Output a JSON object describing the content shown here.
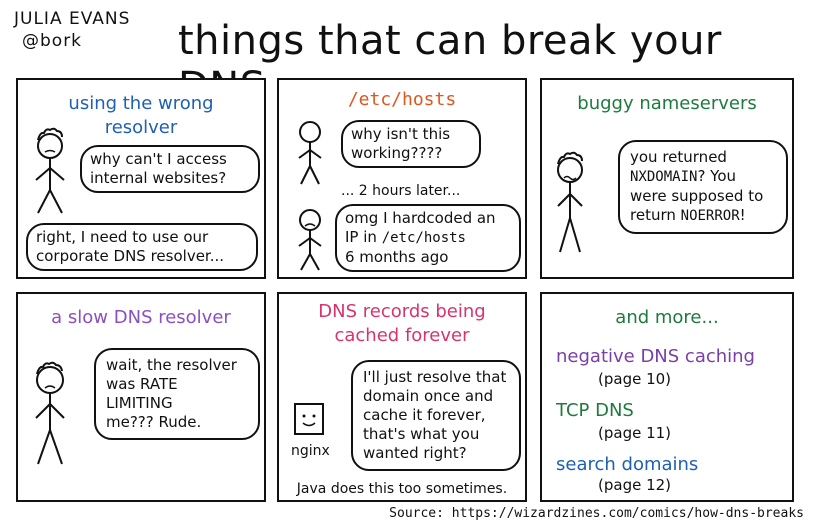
{
  "author": {
    "name": "JULIA EVANS",
    "handle": "@bork"
  },
  "title": "things that can break your DNS",
  "panels": {
    "p1": {
      "title": "using the wrong resolver",
      "bubble1": "why can't I access internal websites?",
      "bubble2": "right, I need to use our corporate DNS resolver..."
    },
    "p2": {
      "title": "/etc/hosts",
      "bubble1": "why isn't this working????",
      "later": "... 2 hours later...",
      "bubble2_pre": "omg I hardcoded an IP in ",
      "bubble2_code": "/etc/hosts",
      "bubble2_post": "6 months ago"
    },
    "p3": {
      "title": "buggy nameservers",
      "l1": "you returned",
      "l2a": "NXDOMAIN",
      "l2b": "? You",
      "l3": "were supposed to",
      "l4a": "return ",
      "l4b": "NOERROR",
      "l4c": "!"
    },
    "p4": {
      "title": "a slow DNS resolver",
      "l1": "wait, the resolver",
      "l2": "was RATE LIMITING",
      "l3": "me??? Rude."
    },
    "p5": {
      "title": "DNS records being cached forever",
      "bubble": "I'll just resolve that domain once and cache it forever, that's what you wanted right?",
      "label": "nginx",
      "footer": "Java does this too sometimes."
    },
    "p6": {
      "title": "and more...",
      "items": [
        {
          "label": "negative DNS caching",
          "page": "(page 10)",
          "color": "#7a3ea8"
        },
        {
          "label": "TCP DNS",
          "page": "(page 11)",
          "color": "#1e7a3e"
        },
        {
          "label": "search domains",
          "page": "(page 12)",
          "color": "#1f5fb4"
        }
      ]
    }
  },
  "source": "Source: https://wizardzines.com/comics/how-dns-breaks",
  "colors": {
    "blue": "#1f5fb4",
    "orange": "#e2551d",
    "green": "#1e7a3e",
    "purple": "#8a50c2",
    "pink": "#d8336e"
  }
}
